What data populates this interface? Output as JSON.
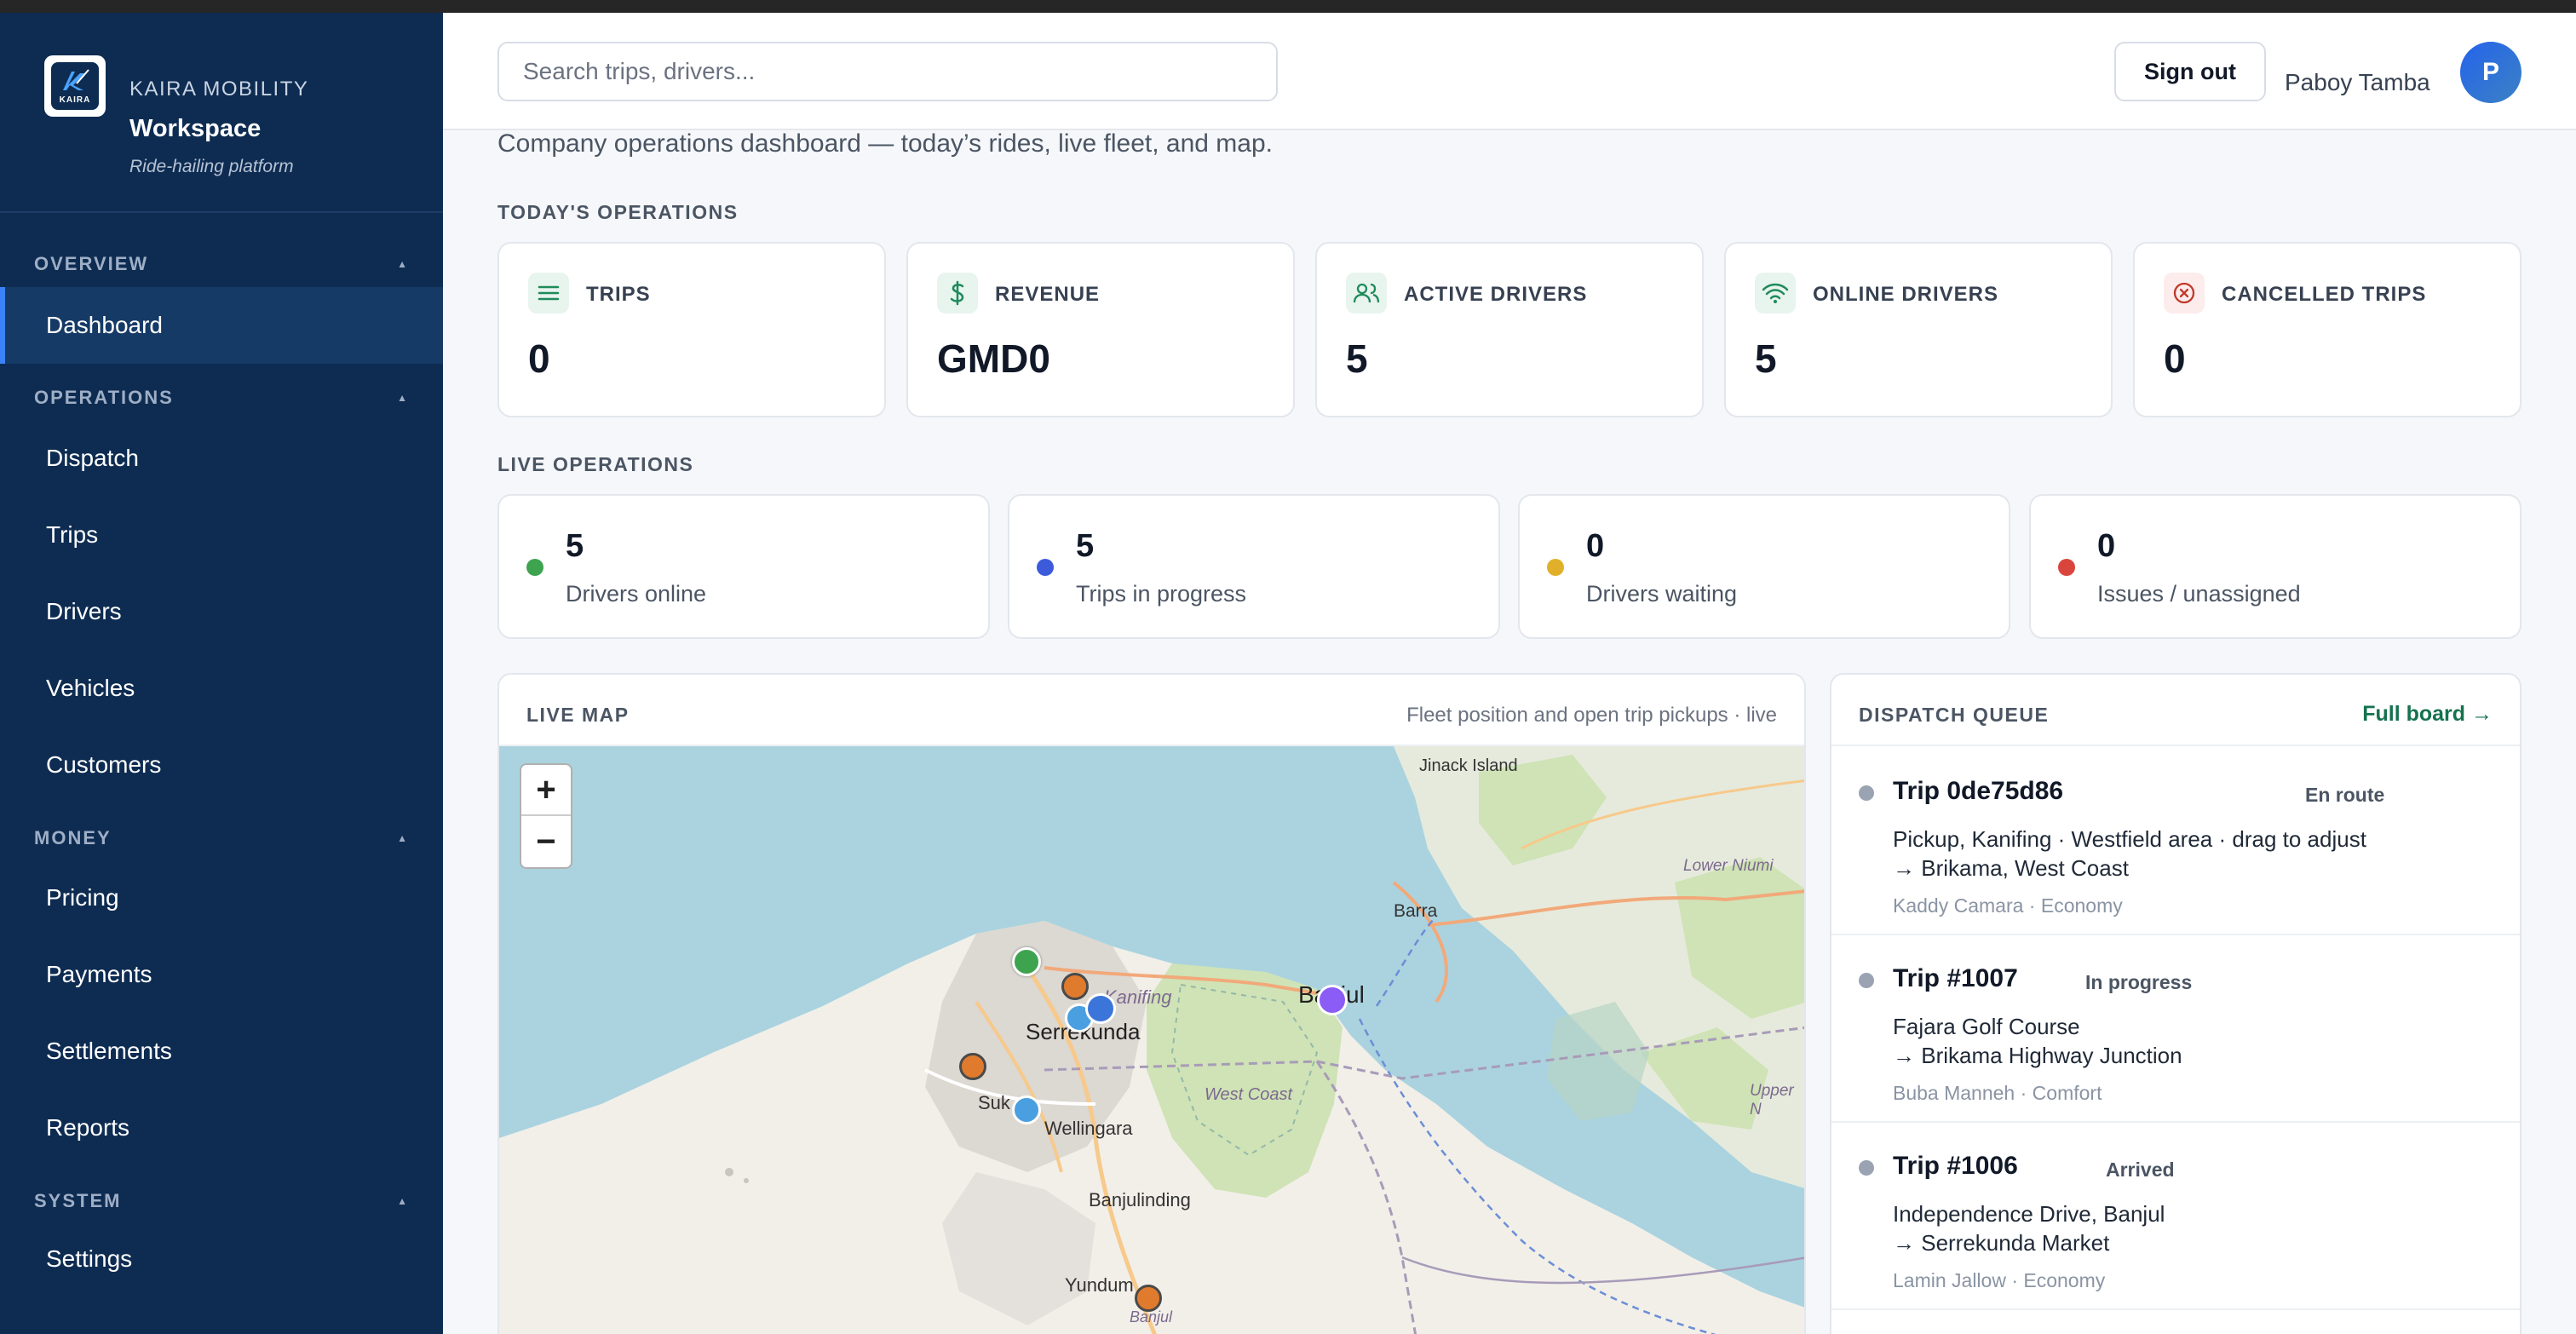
{
  "brand": {
    "company": "KAIRA MOBILITY",
    "workspace": "Workspace",
    "tagline": "Ride-hailing platform",
    "logo_text": "KAIRA"
  },
  "sidebar": {
    "sections": [
      {
        "label": "OVERVIEW",
        "items": [
          "Dashboard"
        ]
      },
      {
        "label": "OPERATIONS",
        "items": [
          "Dispatch",
          "Trips",
          "Drivers",
          "Vehicles",
          "Customers"
        ]
      },
      {
        "label": "MONEY",
        "items": [
          "Pricing",
          "Payments",
          "Settlements",
          "Reports"
        ]
      },
      {
        "label": "SYSTEM",
        "items": [
          "Settings"
        ]
      }
    ],
    "active": "Dashboard"
  },
  "header": {
    "search_placeholder": "Search trips, drivers...",
    "signout_label": "Sign out",
    "user_name": "Paboy Tamba",
    "avatar_initial": "P"
  },
  "page": {
    "subtitle": "Company operations dashboard — today’s rides, live fleet, and map.",
    "today_label": "TODAY'S OPERATIONS",
    "live_label": "LIVE OPERATIONS"
  },
  "stats": [
    {
      "label": "TRIPS",
      "value": "0",
      "icon": "list-icon"
    },
    {
      "label": "REVENUE",
      "value": "GMD0",
      "icon": "dollar-icon"
    },
    {
      "label": "ACTIVE DRIVERS",
      "value": "5",
      "icon": "users-icon"
    },
    {
      "label": "ONLINE DRIVERS",
      "value": "5",
      "icon": "wifi-icon"
    },
    {
      "label": "CANCELLED TRIPS",
      "value": "0",
      "icon": "x-circle-icon"
    }
  ],
  "live": [
    {
      "value": "5",
      "caption": "Drivers online",
      "color": "#3ea34f"
    },
    {
      "value": "5",
      "caption": "Trips in progress",
      "color": "#3b5bdb"
    },
    {
      "value": "0",
      "caption": "Drivers waiting",
      "color": "#e0b02a"
    },
    {
      "value": "0",
      "caption": "Issues / unassigned",
      "color": "#d9453d"
    }
  ],
  "map_panel": {
    "title": "LIVE MAP",
    "note": "Fleet position and open trip pickups · live",
    "zoom_in": "+",
    "zoom_out": "−",
    "places": {
      "jinack": "Jinack Island",
      "lower_niumi": "Lower Niumi",
      "barra": "Barra",
      "banjul": "Banjul",
      "kanifing": "Kanifing",
      "serrekunda": "Serrekunda",
      "west_coast": "West Coast",
      "upper_niumi": "Upper N",
      "sukuta": "Suk",
      "wellingara": "Wellingara",
      "banjulinding": "Banjulinding",
      "yundum": "Yundum",
      "banjul_airport": "Banjul"
    }
  },
  "dispatch": {
    "title": "DISPATCH QUEUE",
    "full_board": "Full board →",
    "items": [
      {
        "title": "Trip 0de75d86",
        "status": "En route",
        "line1": "Pickup, Kanifing · Westfield area · drag to adjust",
        "line2": "→ Brikama, West Coast",
        "meta": "Kaddy Camara · Economy"
      },
      {
        "title": "Trip #1007",
        "status": "In progress",
        "line1": "Fajara Golf Course",
        "line2": "→ Brikama Highway Junction",
        "meta": "Buba Manneh · Comfort"
      },
      {
        "title": "Trip #1006",
        "status": "Arrived",
        "line1": "Independence Drive, Banjul",
        "line2": "→ Serrekunda Market",
        "meta": "Lamin Jallow · Economy"
      }
    ]
  }
}
